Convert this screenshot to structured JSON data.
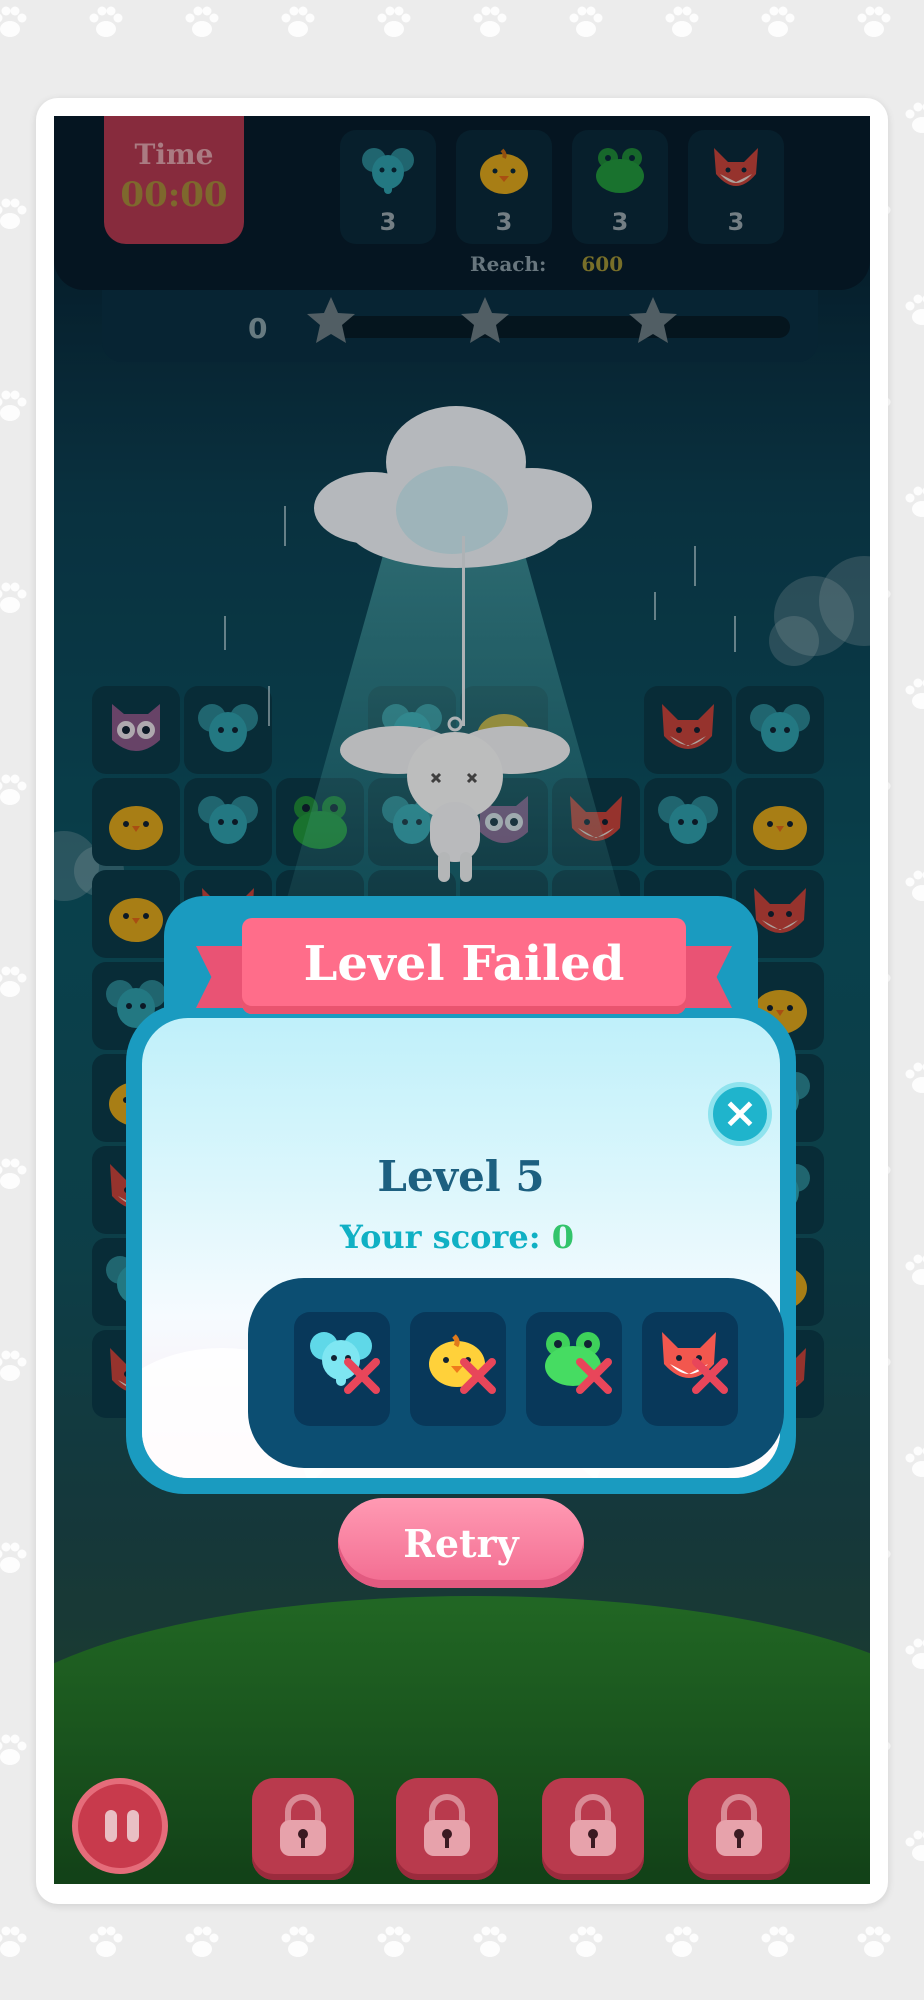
{
  "game": {
    "time_label": "Time",
    "time_value": "00:00",
    "reach_label": "Reach:",
    "reach_value": "600",
    "score": "0",
    "stars_total": 3,
    "goals": [
      {
        "animal": "elephant",
        "count": "3",
        "color": "#2fa8b8"
      },
      {
        "animal": "chick",
        "count": "3",
        "color": "#e8b020"
      },
      {
        "animal": "frog",
        "count": "3",
        "color": "#2aa44a"
      },
      {
        "animal": "fox",
        "count": "3",
        "color": "#d94a40"
      }
    ]
  },
  "modal": {
    "banner": "Level Failed",
    "level_title": "Level 5",
    "score_label": "Your score:",
    "score_value": "0",
    "failed_goals": [
      "elephant-icon",
      "chick-icon",
      "frog-icon",
      "fox-icon"
    ],
    "retry_label": "Retry",
    "close_icon": "close-icon"
  },
  "bottom": {
    "pause_icon": "pause-icon",
    "locked_boosters": 4
  },
  "colors": {
    "accent_pink": "#ff6d8a",
    "modal_blue": "#1a9bc0",
    "score_green": "#32c46b"
  }
}
